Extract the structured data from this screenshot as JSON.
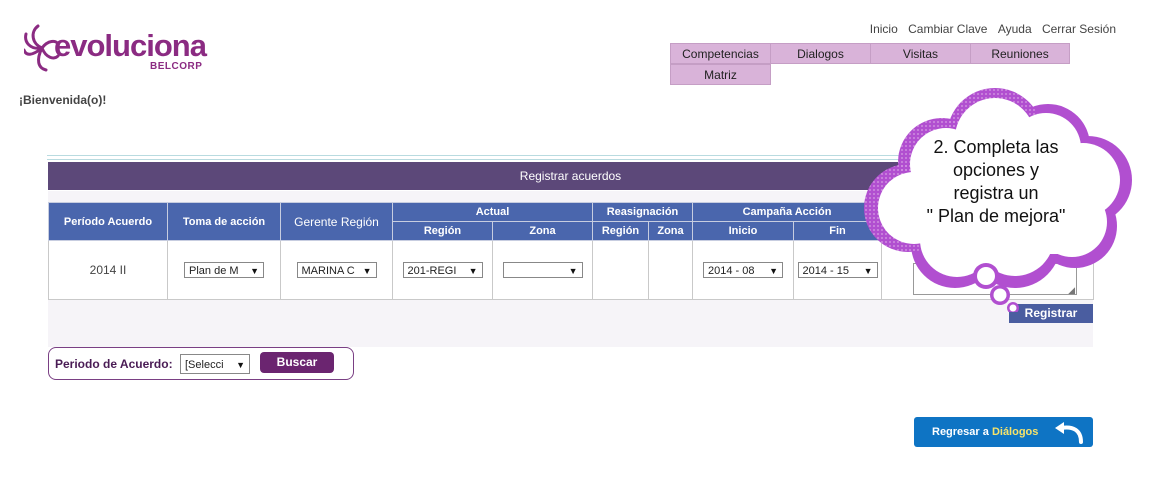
{
  "header": {
    "logo_text": "evoluciona",
    "logo_subtext": "BELCORP",
    "links": [
      "Inicio",
      "Cambiar Clave",
      "Ayuda",
      "Cerrar Sesión"
    ],
    "welcome": "¡Bienvenida(o)!"
  },
  "nav": {
    "tabs": [
      "Competencias",
      "Dialogos",
      "Visitas",
      "Reuniones",
      "Matriz"
    ]
  },
  "panel": {
    "title": "Registrar acuerdos",
    "headers": {
      "periodo": "Período Acuerdo",
      "toma": "Toma de acción",
      "gerente": "Gerente Región",
      "actual": "Actual",
      "reasignacion": "Reasignación",
      "campana": "Campaña Acción",
      "region": "Región",
      "zona": "Zona",
      "inicio": "Inicio",
      "fin": "Fin"
    },
    "row": {
      "periodo": "2014 II",
      "toma": "Plan de M",
      "gerente": "MARINA C",
      "region": "201-REGI",
      "zona": "",
      "inicio": "2014 - 08",
      "fin": "2014 - 15"
    },
    "register_label": "Registrar"
  },
  "filter": {
    "label": "Periodo de Acuerdo:",
    "select_value": "[Selecci",
    "search_label": "Buscar"
  },
  "back_button": {
    "prefix": "Regresar a ",
    "highlight": "Diálogos"
  },
  "callout": {
    "lines": [
      "2. Completa las",
      "opciones y",
      "registra un",
      "\" Plan de mejora\""
    ]
  },
  "colors": {
    "brand_purple": "#8b2b82",
    "header_bar": "#5c4879",
    "table_header": "#4a66ad",
    "back_button": "#0e74c4",
    "cloud_border": "#b14fd0"
  }
}
